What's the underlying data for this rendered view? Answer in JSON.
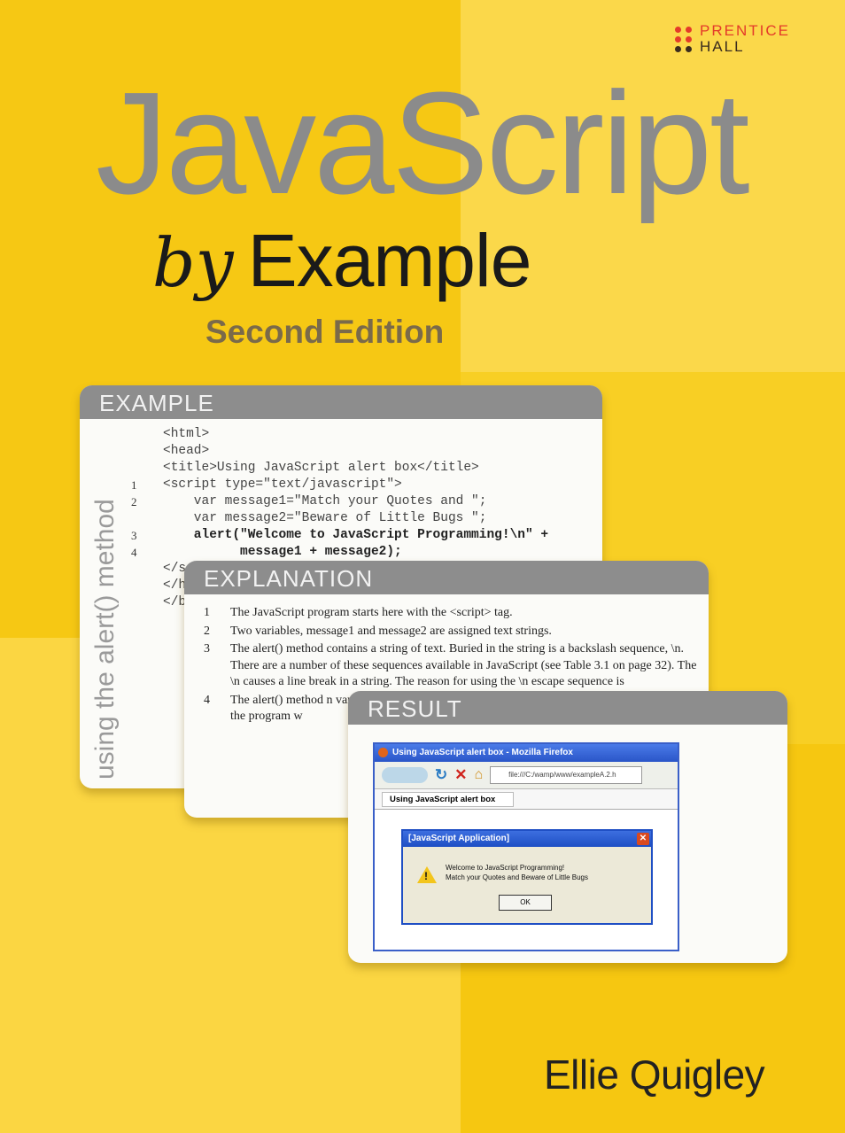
{
  "publisher": {
    "line1": "PRENTICE",
    "line2": "HALL"
  },
  "book": {
    "title": "JavaScript",
    "subtitle_by": "by",
    "subtitle_example": "Example",
    "edition": "Second Edition",
    "author": "Ellie Quigley"
  },
  "example_card": {
    "header": "EXAMPLE",
    "side_label": "using the alert() method",
    "lines": [
      {
        "num": "",
        "text": "<html>",
        "bold": false
      },
      {
        "num": "",
        "text": "<head>",
        "bold": false
      },
      {
        "num": "",
        "text": "<title>Using JavaScript alert box</title>",
        "bold": false
      },
      {
        "num": "1",
        "text": "<script type=\"text/javascript\">",
        "bold": false
      },
      {
        "num": "2",
        "text": "    var message1=\"Match your Quotes and \";",
        "bold": false
      },
      {
        "num": "",
        "text": "    var message2=\"Beware of Little Bugs \";",
        "bold": false
      },
      {
        "num": "3",
        "text": "    alert(\"Welcome to JavaScript Programming!\\n\" +",
        "bold": true
      },
      {
        "num": "4",
        "text": "          message1 + message2);",
        "bold": true
      },
      {
        "num": "",
        "text": "</s",
        "bold": false
      },
      {
        "num": "",
        "text": "</h",
        "bold": false
      },
      {
        "num": "",
        "text": "</b",
        "bold": false
      }
    ]
  },
  "explanation_card": {
    "header": "EXPLANATION",
    "items": [
      {
        "num": "1",
        "text": "The JavaScript program starts here with the <script> tag."
      },
      {
        "num": "2",
        "text": "Two variables, message1 and message2 are assigned text strings."
      },
      {
        "num": "3",
        "text": "The alert() method contains a string of text. Buried in the string is a backslash sequence, \\n. There are a number of these sequences available in JavaScript (see Table 3.1 on page 32). The \\n causes a line break in a string. The reason for using the \\n escape sequence is"
      },
      {
        "num": "4",
        "text": "The alert() method n variables. The + sign and variables together box as shown in the screen, the program w"
      }
    ]
  },
  "result_card": {
    "header": "RESULT",
    "browser": {
      "window_title": "Using JavaScript alert box - Mozilla Firefox",
      "address": "file:///C:/wamp/www/exampleA.2.h",
      "tab_label": "Using JavaScript alert box"
    },
    "dialog": {
      "title": "[JavaScript Application]",
      "close": "✕",
      "message_line1": "Welcome to JavaScript Programming!",
      "message_line2": "Match your Quotes and Beware of Little Bugs",
      "ok": "OK"
    }
  }
}
